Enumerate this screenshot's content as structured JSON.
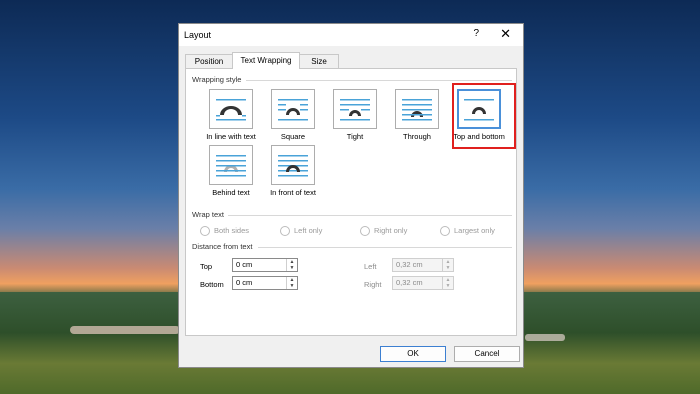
{
  "dialog": {
    "title": "Layout",
    "help_label": "?",
    "close_label": "✕"
  },
  "tabs": [
    {
      "label": "Position"
    },
    {
      "label": "Text Wrapping"
    },
    {
      "label": "Size"
    }
  ],
  "wrapping_style": {
    "heading": "Wrapping style",
    "options": [
      {
        "label": "In line with text",
        "icon": "inline-with-text-icon"
      },
      {
        "label": "Square",
        "icon": "square-wrap-icon"
      },
      {
        "label": "Tight",
        "icon": "tight-wrap-icon"
      },
      {
        "label": "Through",
        "icon": "through-wrap-icon"
      },
      {
        "label": "Top and bottom",
        "icon": "top-and-bottom-wrap-icon",
        "selected": true
      },
      {
        "label": "Behind text",
        "icon": "behind-text-icon"
      },
      {
        "label": "In front of text",
        "icon": "in-front-of-text-icon"
      }
    ]
  },
  "wrap_text": {
    "heading": "Wrap text",
    "options": [
      "Both sides",
      "Left only",
      "Right only",
      "Largest only"
    ]
  },
  "distance": {
    "heading": "Distance from text",
    "top_label": "Top",
    "top_value": "0 cm",
    "bottom_label": "Bottom",
    "bottom_value": "0 cm",
    "left_label": "Left",
    "left_value": "0,32 cm",
    "right_label": "Right",
    "right_value": "0,32 cm"
  },
  "buttons": {
    "ok": "OK",
    "cancel": "Cancel"
  },
  "colors": {
    "selection_highlight": "#e0201e",
    "icon_line_blue": "#4aa3d8",
    "icon_shape": "#333333"
  }
}
